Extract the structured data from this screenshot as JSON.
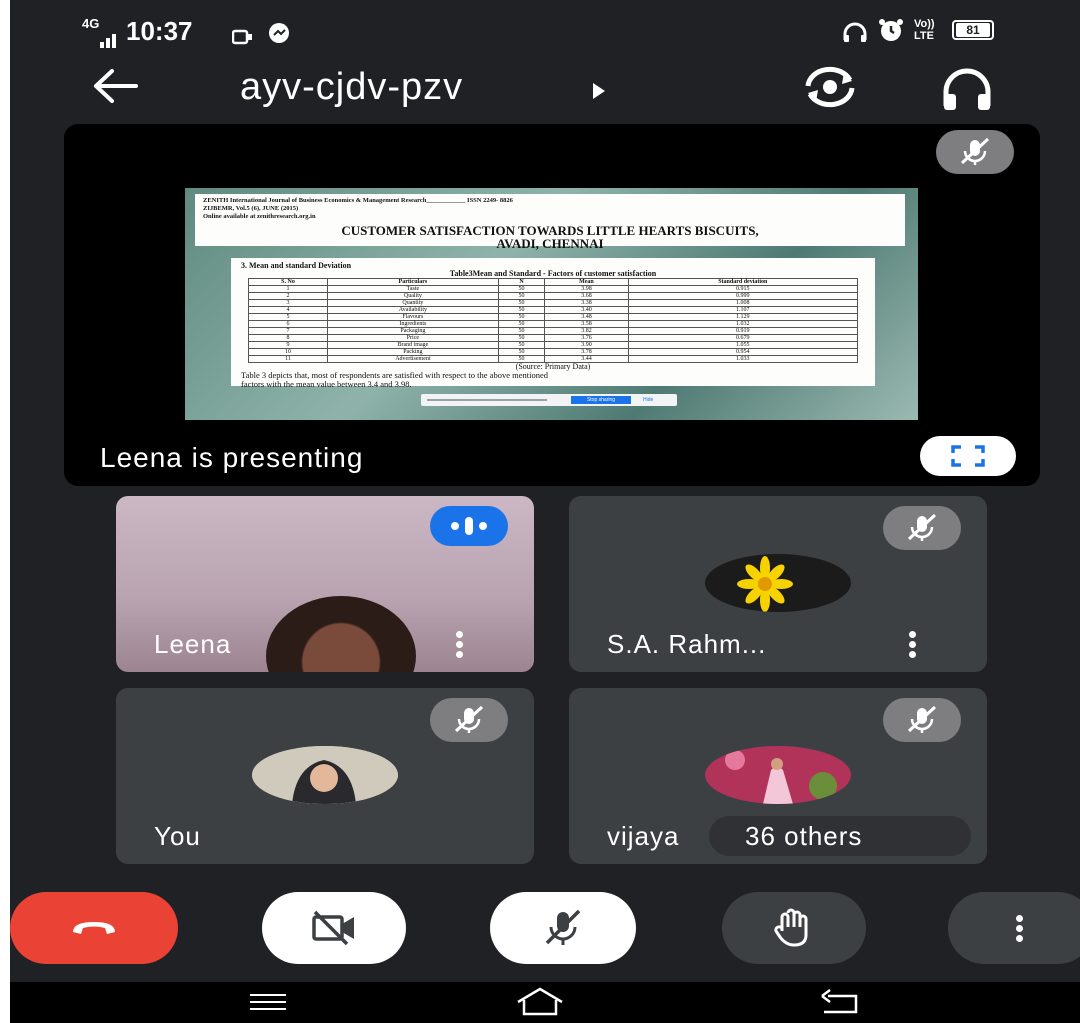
{
  "status_bar": {
    "network": "4G",
    "time": "10:37",
    "lte": "Vo)) LTE",
    "battery": "81"
  },
  "header": {
    "meeting_code": "ayv-cjdv-pzv"
  },
  "presentation": {
    "presenter_text": "Leena is presenting",
    "slide": {
      "journal_line1": "ZENITH International Journal of Business Economics & Management Research____________ ISSN 2249- 8826",
      "journal_line2": "ZIJBEMR, Vol.5 (6), JUNE (2015)",
      "journal_line3": "Online available at zenithresearch.org.in",
      "title_line1": "CUSTOMER SATISFACTION TOWARDS LITTLE HEARTS BISCUITS,",
      "title_line2": "AVADI, CHENNAI",
      "section_heading": "3. Mean and standard Deviation",
      "table_caption": "Table3Mean and Standard - Factors of customer satisfaction",
      "table_headers": [
        "S. No",
        "Particulars",
        "N",
        "Mean",
        "Standard deviation"
      ],
      "table_rows": [
        [
          "1",
          "Taste",
          "50",
          "3.98",
          "0.915"
        ],
        [
          "2",
          "Quality",
          "50",
          "3.68",
          "0.999"
        ],
        [
          "3",
          "Quantity",
          "50",
          "3.38",
          "1.008"
        ],
        [
          "4",
          "Availability",
          "50",
          "3.40",
          "1.107"
        ],
        [
          "5",
          "Flavours",
          "50",
          "3.48",
          "1.129"
        ],
        [
          "6",
          "Ingredients",
          "50",
          "3.58",
          "1.032"
        ],
        [
          "7",
          "Packaging",
          "50",
          "3.82",
          "0.919"
        ],
        [
          "8",
          "Price",
          "50",
          "3.76",
          "0.679"
        ],
        [
          "9",
          "Brand image",
          "50",
          "3.90",
          "1.055"
        ],
        [
          "10",
          "Packing",
          "50",
          "3.78",
          "0.954"
        ],
        [
          "11",
          "Advertisement",
          "50",
          "3.44",
          "1.033"
        ]
      ],
      "source_note": "(Source: Primary Data)",
      "paragraph_line1": "Table 3 depicts that, most of respondents are satisfied with respect to the above mentioned",
      "paragraph_line2": "factors with the mean value between 3.4 and 3.98.",
      "share_bar_button": "Stop sharing",
      "share_bar_hide": "Hide"
    }
  },
  "participants": [
    {
      "name": "Leena"
    },
    {
      "name": "S.A. Rahm..."
    },
    {
      "name": "You"
    },
    {
      "name": "vijaya"
    }
  ],
  "others_badge": "36 others",
  "colors": {
    "background": "#202124",
    "tile": "#3c4043",
    "end_call": "#ea4335",
    "speaking_badge": "#1a73e8",
    "muted_pill": "#7e7e80"
  }
}
